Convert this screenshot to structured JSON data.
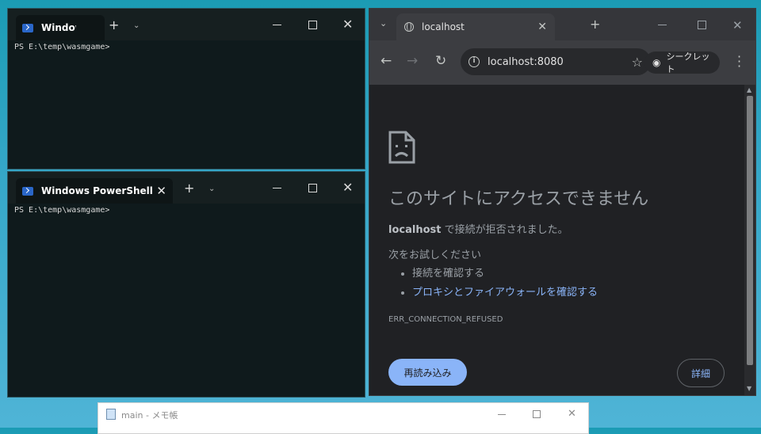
{
  "terminal_top": {
    "tab_title": "Windows PowerShell",
    "prompt": "PS E:\\temp\\wasmgame>"
  },
  "terminal_bottom": {
    "tab_title": "Windows PowerShell",
    "prompt": "PS E:\\temp\\wasmgame>"
  },
  "browser": {
    "tab_title": "localhost",
    "url": "localhost:8080",
    "incognito_label": "シークレット",
    "error": {
      "title": "このサイトにアクセスできません",
      "host": "localhost",
      "message": " で接続が拒否されました。",
      "try_label": "次をお試しください",
      "suggestions": [
        {
          "text": "接続を確認する",
          "link": false
        },
        {
          "text": "プロキシとファイアウォールを確認する",
          "link": true
        }
      ],
      "code": "ERR_CONNECTION_REFUSED",
      "reload_label": "再読み込み",
      "details_label": "詳細"
    }
  },
  "notepad": {
    "title": "main - メモ帳"
  },
  "colors": {
    "link": "#8ab4f8",
    "terminal_bg": "#0f1a1c",
    "browser_bg": "#202124"
  }
}
